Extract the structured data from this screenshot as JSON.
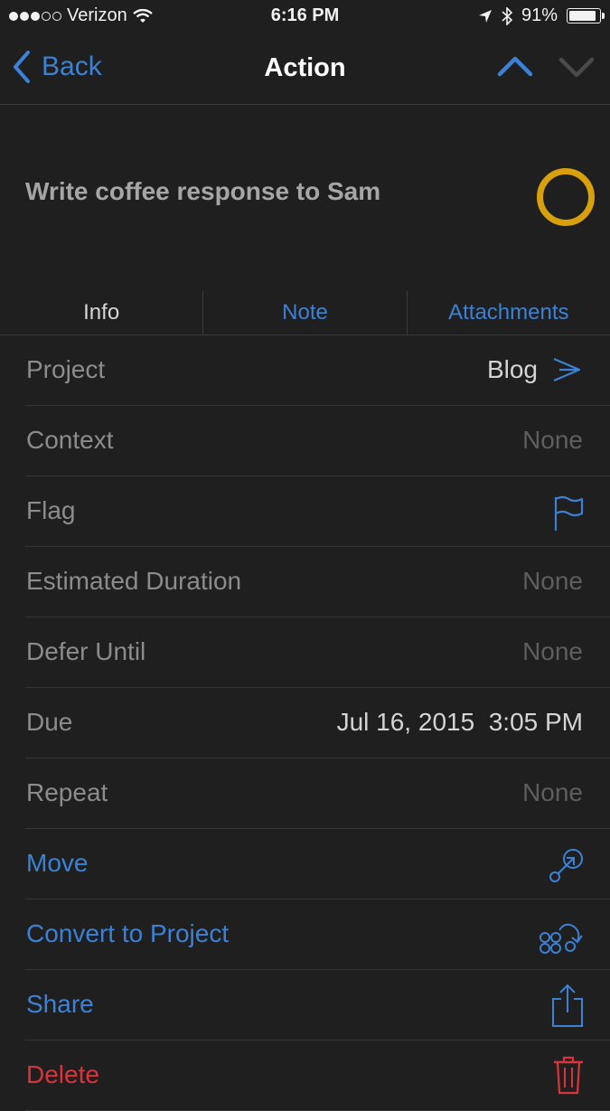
{
  "status_bar": {
    "carrier": "Verizon",
    "time": "6:16 PM",
    "battery": "91%",
    "icons": [
      "signal-dots-icon",
      "wifi-icon",
      "location-icon",
      "bluetooth-icon",
      "battery-icon"
    ]
  },
  "nav": {
    "back_label": "Back",
    "title": "Action"
  },
  "action": {
    "title": "Write coffee response to Sam",
    "status_color": "#d8a10b"
  },
  "tabs": [
    {
      "label": "Info",
      "selected": true
    },
    {
      "label": "Note",
      "selected": false
    },
    {
      "label": "Attachments",
      "selected": false
    }
  ],
  "fields": {
    "project": {
      "label": "Project",
      "value": "Blog"
    },
    "context": {
      "label": "Context",
      "value": "None"
    },
    "flag": {
      "label": "Flag"
    },
    "duration": {
      "label": "Estimated Duration",
      "value": "None"
    },
    "defer": {
      "label": "Defer Until",
      "value": "None"
    },
    "due": {
      "label": "Due",
      "value": "Jul 16, 2015  3:05 PM"
    },
    "repeat": {
      "label": "Repeat",
      "value": "None"
    }
  },
  "actions": {
    "move": "Move",
    "convert": "Convert to Project",
    "share": "Share",
    "delete": "Delete"
  },
  "colors": {
    "background": "#1f1f1f",
    "accent": "#3b82d6",
    "destructive": "#d9343c"
  }
}
